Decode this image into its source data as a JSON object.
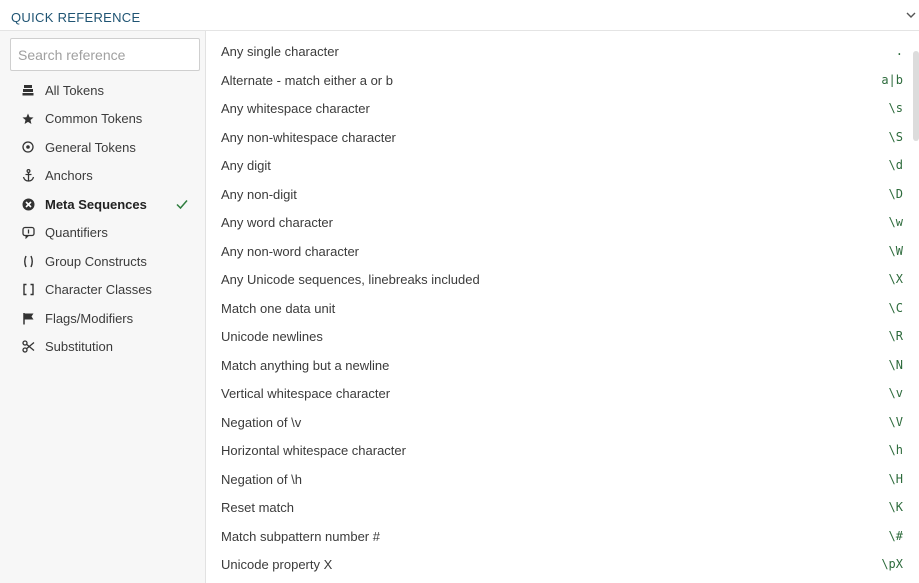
{
  "header": {
    "title": "QUICK REFERENCE",
    "toggle_icon": "chevron-down-icon"
  },
  "sidebar": {
    "search": {
      "placeholder": "Search reference",
      "value": ""
    },
    "items": [
      {
        "label": "All Tokens",
        "icon": "stack-icon",
        "active": false
      },
      {
        "label": "Common Tokens",
        "icon": "star-icon",
        "active": false
      },
      {
        "label": "General Tokens",
        "icon": "target-icon",
        "active": false
      },
      {
        "label": "Anchors",
        "icon": "anchor-icon",
        "active": false
      },
      {
        "label": "Meta Sequences",
        "icon": "meta-icon",
        "active": true
      },
      {
        "label": "Quantifiers",
        "icon": "quantifier-icon",
        "active": false
      },
      {
        "label": "Group Constructs",
        "icon": "parentheses-icon",
        "active": false
      },
      {
        "label": "Character Classes",
        "icon": "brackets-icon",
        "active": false
      },
      {
        "label": "Flags/Modifiers",
        "icon": "flag-icon",
        "active": false
      },
      {
        "label": "Substitution",
        "icon": "scissors-icon",
        "active": false
      }
    ]
  },
  "main": {
    "rows": [
      {
        "description": "Any single character",
        "token": "."
      },
      {
        "description": "Alternate - match either a or b",
        "token": "a|b"
      },
      {
        "description": "Any whitespace character",
        "token": "\\s"
      },
      {
        "description": "Any non-whitespace character",
        "token": "\\S"
      },
      {
        "description": "Any digit",
        "token": "\\d"
      },
      {
        "description": "Any non-digit",
        "token": "\\D"
      },
      {
        "description": "Any word character",
        "token": "\\w"
      },
      {
        "description": "Any non-word character",
        "token": "\\W"
      },
      {
        "description": "Any Unicode sequences, linebreaks included",
        "token": "\\X"
      },
      {
        "description": "Match one data unit",
        "token": "\\C"
      },
      {
        "description": "Unicode newlines",
        "token": "\\R"
      },
      {
        "description": "Match anything but a newline",
        "token": "\\N"
      },
      {
        "description": "Vertical whitespace character",
        "token": "\\v"
      },
      {
        "description": "Negation of \\v",
        "token": "\\V"
      },
      {
        "description": "Horizontal whitespace character",
        "token": "\\h"
      },
      {
        "description": "Negation of \\h",
        "token": "\\H"
      },
      {
        "description": "Reset match",
        "token": "\\K"
      },
      {
        "description": "Match subpattern number #",
        "token": "\\#"
      },
      {
        "description": "Unicode property X",
        "token": "\\pX"
      }
    ]
  },
  "colors": {
    "title": "#1f5473",
    "token": "#2d6b3c",
    "check": "#2e7d3e",
    "sidebar_bg": "#f7f7f7"
  }
}
